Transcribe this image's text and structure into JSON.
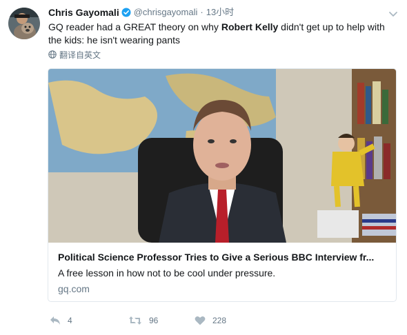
{
  "tweet": {
    "author_name": "Chris Gayomali",
    "author_handle": "@chrisgayomali",
    "separator": "·",
    "timestamp": "13小时",
    "text_before": "GQ reader had a GREAT theory on why ",
    "text_bold": "Robert Kelly",
    "text_after": " didn't get up to help with the kids: he isn't wearing pants",
    "translate_label": "翻译自英文"
  },
  "card": {
    "title": "Political Science Professor Tries to Give a Serious BBC Interview fr...",
    "description": "A free lesson in how not to be cool under pressure.",
    "domain": "gq.com"
  },
  "actions": {
    "reply_count": "4",
    "retweet_count": "96",
    "like_count": "228"
  },
  "colors": {
    "verified_blue": "#1da1f2",
    "muted_gray": "#657786",
    "border": "#e1e8ed"
  },
  "icons": [
    "verified-badge-icon",
    "caret-down-icon",
    "globe-icon",
    "reply-icon",
    "retweet-icon",
    "heart-icon"
  ]
}
